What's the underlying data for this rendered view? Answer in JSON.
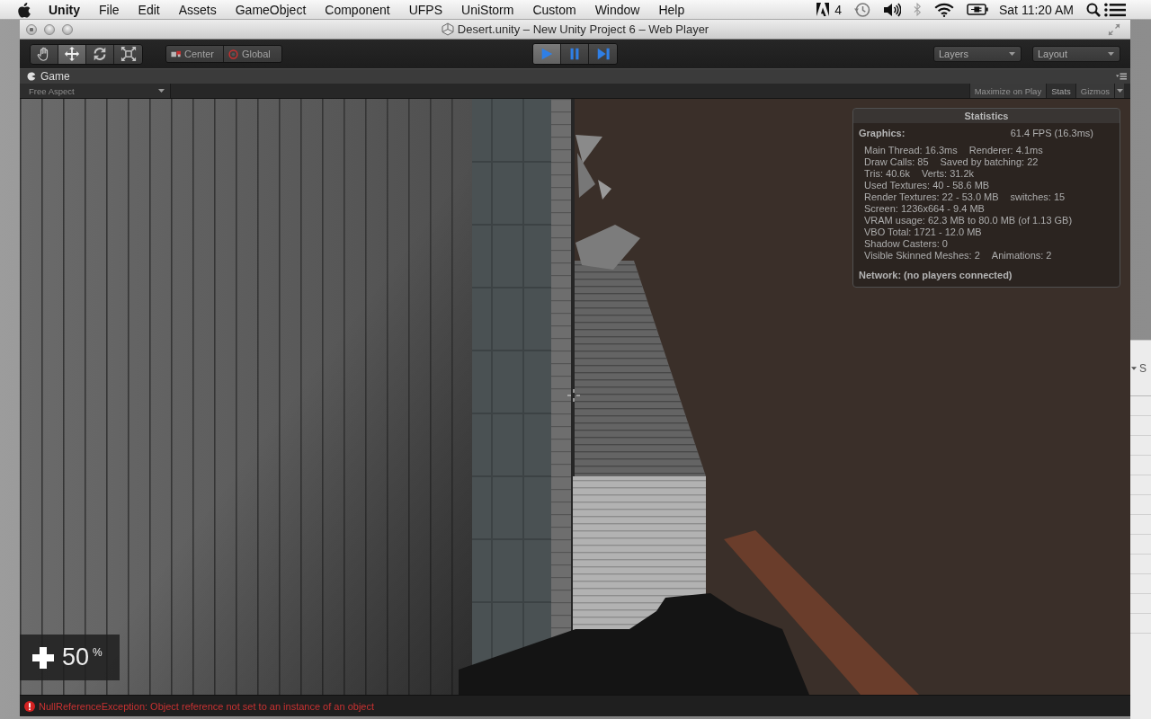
{
  "menu_bar": {
    "items": [
      {
        "label": "Unity",
        "kind": "app"
      },
      {
        "label": "File",
        "kind": "menu"
      },
      {
        "label": "Edit",
        "kind": "menu"
      },
      {
        "label": "Assets",
        "kind": "menu"
      },
      {
        "label": "GameObject",
        "kind": "menu"
      },
      {
        "label": "Component",
        "kind": "menu"
      },
      {
        "label": "UFPS",
        "kind": "menu"
      },
      {
        "label": "UniStorm",
        "kind": "menu"
      },
      {
        "label": "Custom",
        "kind": "menu"
      },
      {
        "label": "Window",
        "kind": "menu"
      },
      {
        "label": "Help",
        "kind": "menu"
      }
    ],
    "badge_count": "4",
    "clock": "Sat 11:20 AM"
  },
  "window": {
    "title": "Desert.unity – New Unity Project 6 – Web Player"
  },
  "toolbar": {
    "tools": [
      {
        "kind": "hand",
        "selected": false
      },
      {
        "kind": "move",
        "selected": true
      },
      {
        "kind": "rotate",
        "selected": false
      },
      {
        "kind": "scale",
        "selected": false
      }
    ],
    "pivot": [
      {
        "kind": "center",
        "label": "Center"
      },
      {
        "kind": "global",
        "label": "Global"
      }
    ],
    "playback": [
      {
        "kind": "play",
        "selected": true
      },
      {
        "kind": "pause",
        "selected": false
      },
      {
        "kind": "step",
        "selected": false
      }
    ],
    "dropdowns": [
      {
        "label": "Layers"
      },
      {
        "label": "Layout"
      }
    ]
  },
  "game_tab": {
    "label": "Game"
  },
  "game_toolbar": {
    "aspect": "Free Aspect",
    "toggles": [
      {
        "label": "Maximize on Play",
        "kind": "toggle",
        "selected": false
      },
      {
        "label": "Stats",
        "kind": "toggle",
        "selected": true
      },
      {
        "label": "Gizmos",
        "kind": "dropdown",
        "selected": false
      }
    ]
  },
  "statistics": {
    "title": "Statistics",
    "graphics_label": "Graphics:",
    "graphics_value": "61.4 FPS (16.3ms)",
    "lines": [
      [
        "Main Thread: 16.3ms",
        "Renderer: 4.1ms"
      ],
      [
        "Draw Calls: 85",
        "Saved by batching: 22"
      ],
      [
        "Tris: 40.6k",
        "Verts: 31.2k"
      ],
      [
        "Used Textures: 40 - 58.6 MB"
      ],
      [
        "Render Textures: 22 - 53.0 MB",
        "switches: 15"
      ],
      [
        "Screen: 1236x664 - 9.4 MB"
      ],
      [
        "VRAM usage: 62.3 MB to 80.0 MB (of 1.13 GB)"
      ],
      [
        "VBO Total: 1721 - 12.0 MB"
      ],
      [
        "Shadow Casters: 0"
      ],
      [
        "Visible Skinned Meshes: 2",
        "Animations: 2"
      ]
    ],
    "network": "Network: (no players connected)"
  },
  "hud": {
    "health": "50",
    "unit": "%"
  },
  "status_bar": {
    "kind": "error",
    "message": "NullReferenceException: Object reference not set to an instance of an object"
  },
  "background_window": {
    "label": "S"
  }
}
